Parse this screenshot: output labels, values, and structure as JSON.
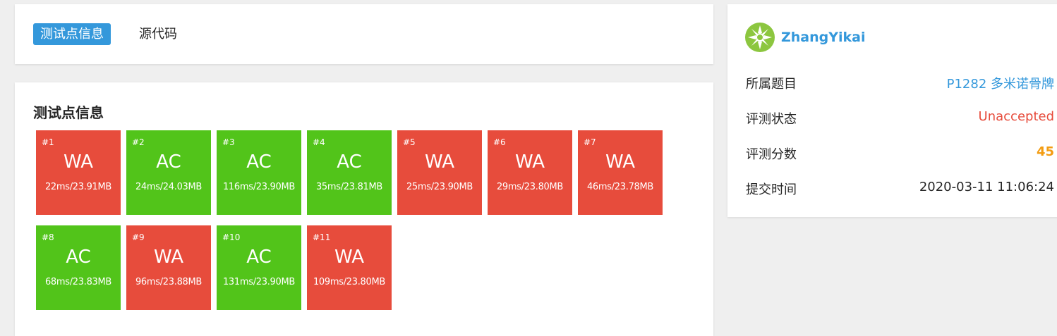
{
  "tabs": [
    {
      "label": "测试点信息",
      "active": true
    },
    {
      "label": "源代码",
      "active": false
    }
  ],
  "cases_title": "测试点信息",
  "colors": {
    "AC": "#52c41a",
    "WA": "#e74c3c",
    "accent": "#3498db",
    "score": "#f39c12"
  },
  "cases": [
    {
      "num": "#1",
      "verdict": "WA",
      "usage": "22ms/23.91MB"
    },
    {
      "num": "#2",
      "verdict": "AC",
      "usage": "24ms/24.03MB"
    },
    {
      "num": "#3",
      "verdict": "AC",
      "usage": "116ms/23.90MB"
    },
    {
      "num": "#4",
      "verdict": "AC",
      "usage": "35ms/23.81MB"
    },
    {
      "num": "#5",
      "verdict": "WA",
      "usage": "25ms/23.90MB"
    },
    {
      "num": "#6",
      "verdict": "WA",
      "usage": "29ms/23.80MB"
    },
    {
      "num": "#7",
      "verdict": "WA",
      "usage": "46ms/23.78MB"
    },
    {
      "num": "#8",
      "verdict": "AC",
      "usage": "68ms/23.83MB"
    },
    {
      "num": "#9",
      "verdict": "WA",
      "usage": "96ms/23.88MB"
    },
    {
      "num": "#10",
      "verdict": "AC",
      "usage": "131ms/23.90MB"
    },
    {
      "num": "#11",
      "verdict": "WA",
      "usage": "109ms/23.80MB"
    }
  ],
  "info": {
    "username": "ZhangYikai",
    "avatar_icon": "green-snowflake-avatar",
    "rows": [
      {
        "label": "所属题目",
        "value": "P1282 多米诺骨牌"
      },
      {
        "label": "评测状态",
        "value": "Unaccepted"
      },
      {
        "label": "评测分数",
        "value": "45"
      },
      {
        "label": "提交时间",
        "value": "2020-03-11 11:06:24"
      }
    ]
  }
}
